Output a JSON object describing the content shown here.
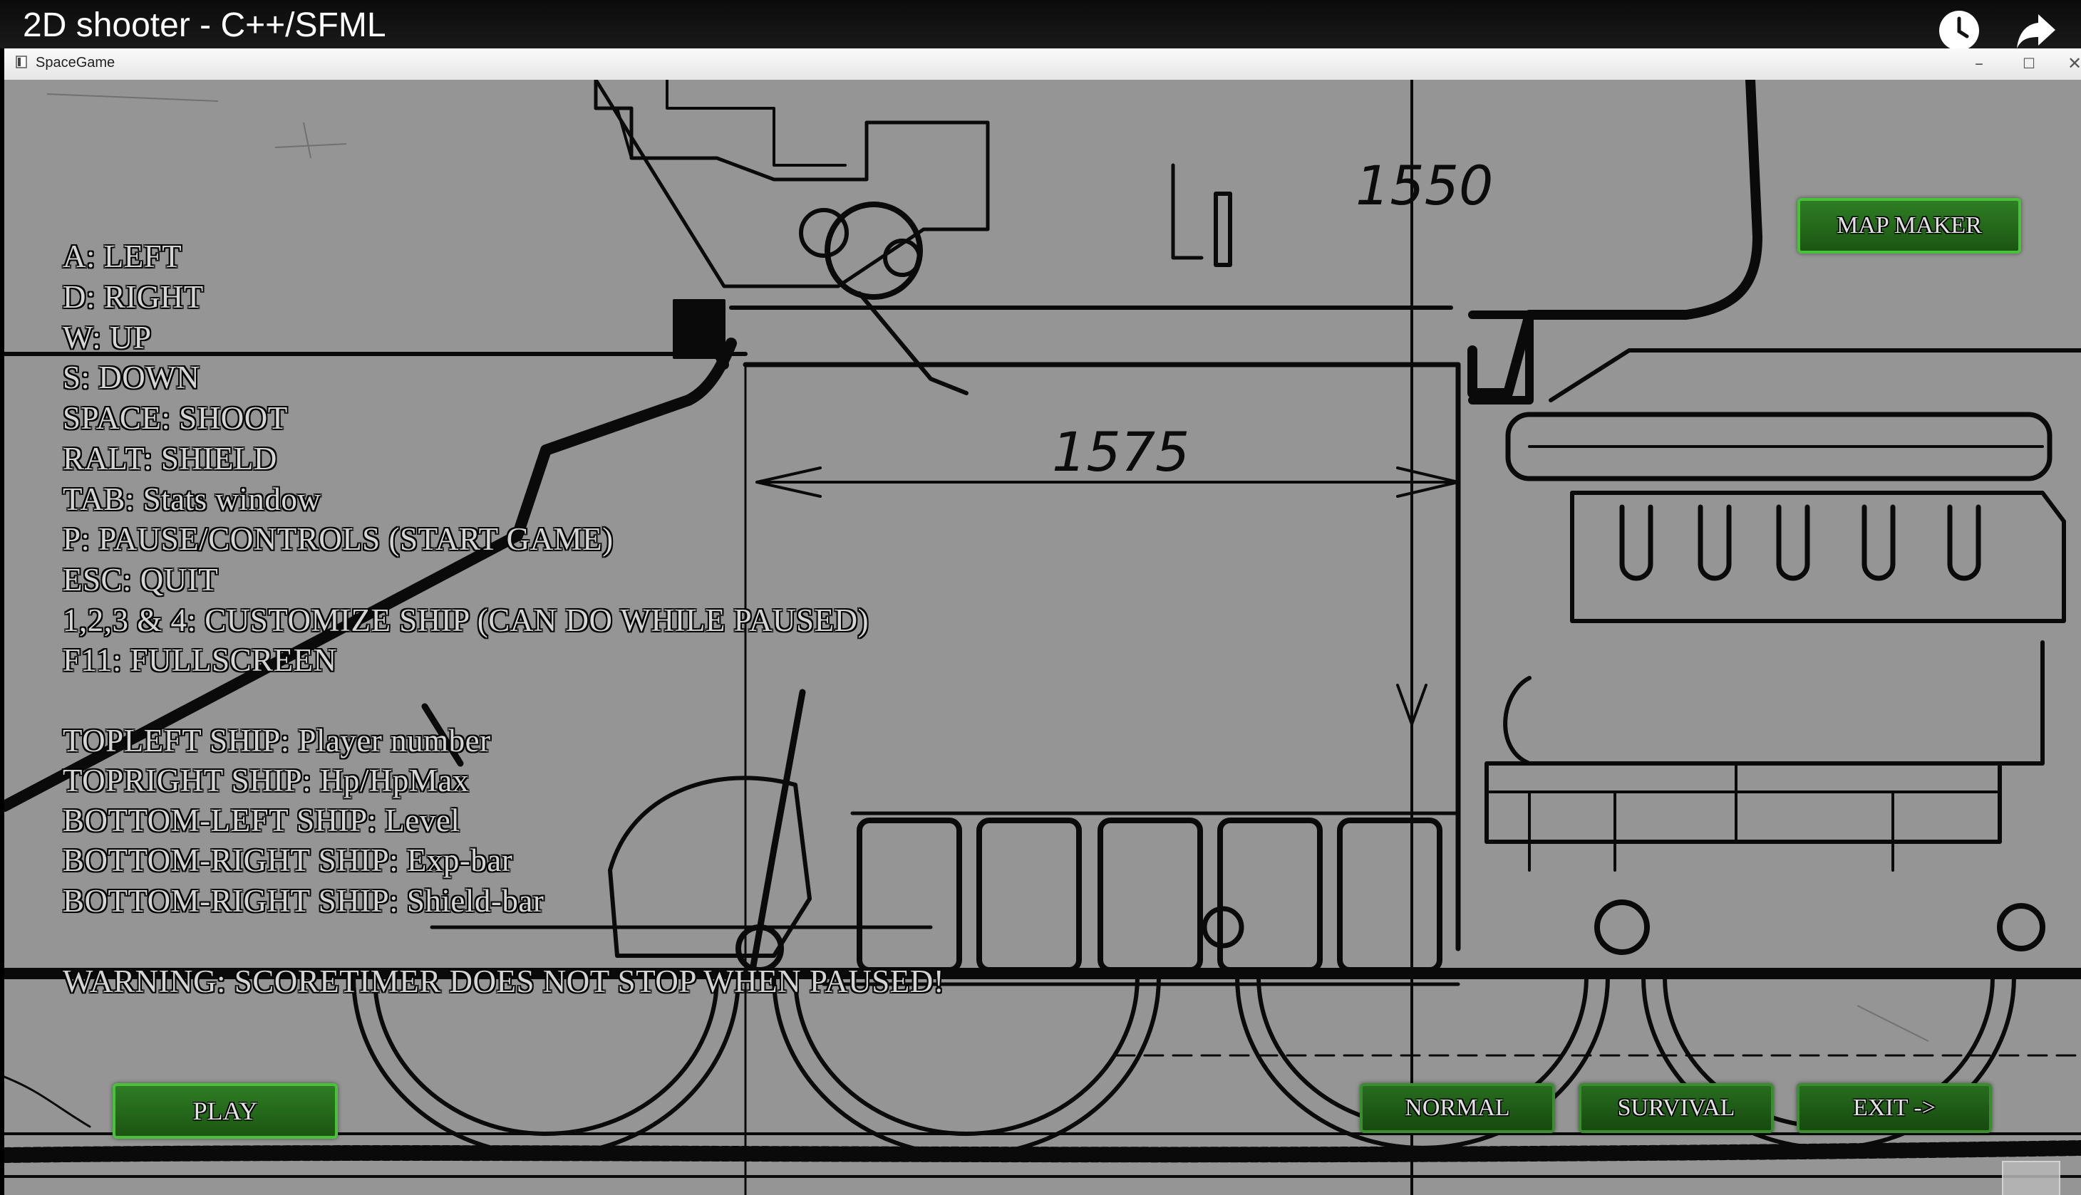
{
  "video": {
    "title": "2D shooter - C++/SFML",
    "watch_later_icon": "clock-icon",
    "share_icon": "share-arrow-icon"
  },
  "window": {
    "title": "SpaceGame",
    "minimize": "–",
    "maximize": "☐",
    "close": "✕"
  },
  "blueprint": {
    "dimension_top": "1550",
    "dimension_mid": "1575"
  },
  "controls": {
    "lines": [
      "A: LEFT",
      "D: RIGHT",
      "W: UP",
      "S: DOWN",
      "SPACE: SHOOT",
      "RALT: SHIELD",
      "TAB: Stats window",
      "P: PAUSE/CONTROLS (START GAME)",
      "ESC: QUIT",
      "1,2,3 & 4: CUSTOMIZE SHIP (CAN DO WHILE PAUSED)",
      "F11: FULLSCREEN",
      "TOPLEFT SHIP: Player number",
      "TOPRIGHT SHIP: Hp/HpMax",
      "BOTTOM-LEFT SHIP: Level",
      "BOTTOM-RIGHT SHIP: Exp-bar",
      "BOTTOM-RIGHT SHIP: Shield-bar",
      "WARNING: SCORETIMER DOES NOT STOP WHEN PAUSED!"
    ]
  },
  "buttons": {
    "map_maker": "MAP MAKER",
    "play": "PLAY",
    "normal": "NORMAL",
    "survival": "SURVIVAL",
    "exit": "EXIT ->"
  },
  "colors": {
    "button_fill": "#236a1a",
    "button_border": "#49c23a",
    "background": "#959595"
  }
}
